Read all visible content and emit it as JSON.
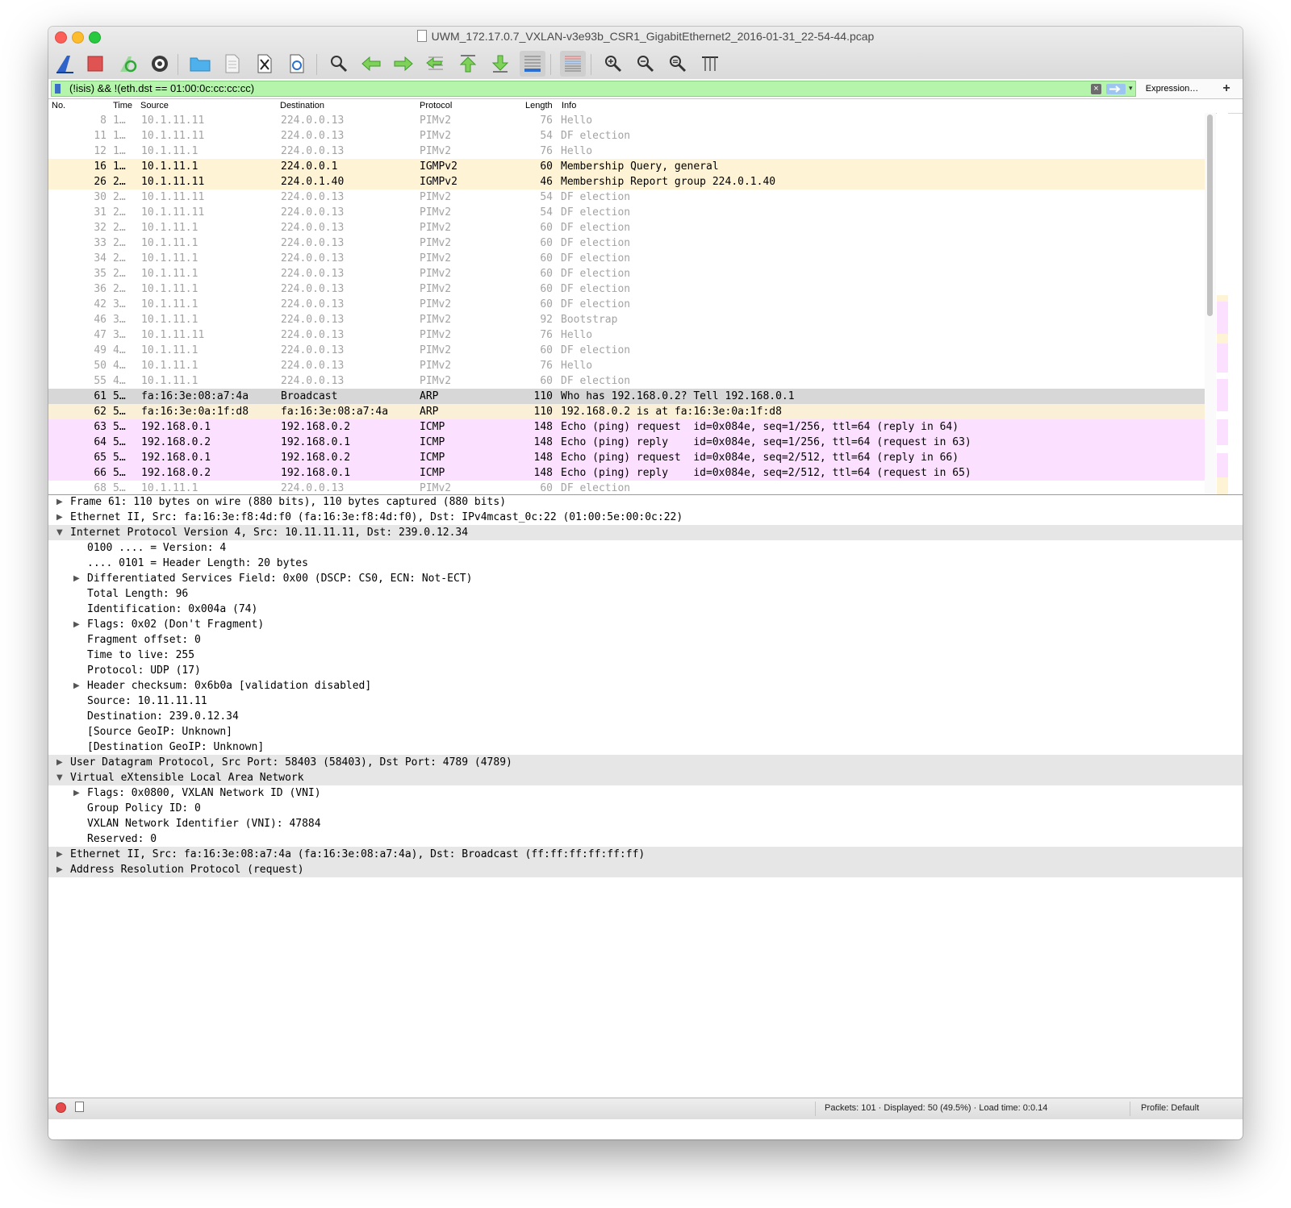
{
  "window": {
    "title": "UWM_172.17.0.7_VXLAN-v3e93b_CSR1_GigabitEthernet2_2016-01-31_22-54-44.pcap"
  },
  "toolbar": {
    "buttons": [
      {
        "name": "start-capture",
        "icon": "shark-fin-icon"
      },
      {
        "name": "stop-capture",
        "icon": "stop-square-icon"
      },
      {
        "name": "restart-capture",
        "icon": "restart-icon"
      },
      {
        "name": "capture-options",
        "icon": "gear-icon"
      },
      {
        "name": "open-file",
        "icon": "folder-icon"
      },
      {
        "name": "save-file",
        "icon": "file-icon"
      },
      {
        "name": "close-file",
        "icon": "close-file-icon"
      },
      {
        "name": "reload-file",
        "icon": "reload-icon"
      },
      {
        "name": "find-packet",
        "icon": "magnifier-icon"
      },
      {
        "name": "go-back",
        "icon": "arrow-left-icon"
      },
      {
        "name": "go-forward",
        "icon": "arrow-right-icon"
      },
      {
        "name": "go-to-packet",
        "icon": "goto-packet-icon"
      },
      {
        "name": "go-first",
        "icon": "arrow-up-icon"
      },
      {
        "name": "go-last",
        "icon": "arrow-down-icon"
      },
      {
        "name": "autoscroll",
        "icon": "autoscroll-icon"
      },
      {
        "name": "colorize",
        "icon": "colorize-icon"
      },
      {
        "name": "zoom-in",
        "icon": "zoom-in-icon"
      },
      {
        "name": "zoom-out",
        "icon": "zoom-out-icon"
      },
      {
        "name": "zoom-normal",
        "icon": "zoom-normal-icon"
      },
      {
        "name": "resize-columns",
        "icon": "resize-columns-icon"
      }
    ]
  },
  "filter": {
    "value": "(!isis) && !(eth.dst == 01:00:0c:cc:cc:cc)",
    "clear_glyph": "×",
    "expression_label": "Expression…",
    "add_label": "+"
  },
  "packet_list": {
    "columns": [
      "No.",
      "Time",
      "Source",
      "Destination",
      "Protocol",
      "Length",
      "Info"
    ],
    "rows": [
      {
        "no": "8",
        "time": "1…",
        "src": "10.1.11.11",
        "dst": "224.0.0.13",
        "proto": "PIMv2",
        "len": "76",
        "info": "Hello",
        "style": "dim"
      },
      {
        "no": "11",
        "time": "1…",
        "src": "10.1.11.11",
        "dst": "224.0.0.13",
        "proto": "PIMv2",
        "len": "54",
        "info": "DF election",
        "style": "dim"
      },
      {
        "no": "12",
        "time": "1…",
        "src": "10.1.11.1",
        "dst": "224.0.0.13",
        "proto": "PIMv2",
        "len": "76",
        "info": "Hello",
        "style": "dim"
      },
      {
        "no": "16",
        "time": "1…",
        "src": "10.1.11.1",
        "dst": "224.0.0.1",
        "proto": "IGMPv2",
        "len": "60",
        "info": "Membership Query, general",
        "style": "igmp"
      },
      {
        "no": "26",
        "time": "2…",
        "src": "10.1.11.11",
        "dst": "224.0.1.40",
        "proto": "IGMPv2",
        "len": "46",
        "info": "Membership Report group 224.0.1.40",
        "style": "igmp"
      },
      {
        "no": "30",
        "time": "2…",
        "src": "10.1.11.11",
        "dst": "224.0.0.13",
        "proto": "PIMv2",
        "len": "54",
        "info": "DF election",
        "style": "dim"
      },
      {
        "no": "31",
        "time": "2…",
        "src": "10.1.11.11",
        "dst": "224.0.0.13",
        "proto": "PIMv2",
        "len": "54",
        "info": "DF election",
        "style": "dim"
      },
      {
        "no": "32",
        "time": "2…",
        "src": "10.1.11.1",
        "dst": "224.0.0.13",
        "proto": "PIMv2",
        "len": "60",
        "info": "DF election",
        "style": "dim"
      },
      {
        "no": "33",
        "time": "2…",
        "src": "10.1.11.1",
        "dst": "224.0.0.13",
        "proto": "PIMv2",
        "len": "60",
        "info": "DF election",
        "style": "dim"
      },
      {
        "no": "34",
        "time": "2…",
        "src": "10.1.11.1",
        "dst": "224.0.0.13",
        "proto": "PIMv2",
        "len": "60",
        "info": "DF election",
        "style": "dim"
      },
      {
        "no": "35",
        "time": "2…",
        "src": "10.1.11.1",
        "dst": "224.0.0.13",
        "proto": "PIMv2",
        "len": "60",
        "info": "DF election",
        "style": "dim"
      },
      {
        "no": "36",
        "time": "2…",
        "src": "10.1.11.1",
        "dst": "224.0.0.13",
        "proto": "PIMv2",
        "len": "60",
        "info": "DF election",
        "style": "dim"
      },
      {
        "no": "42",
        "time": "3…",
        "src": "10.1.11.1",
        "dst": "224.0.0.13",
        "proto": "PIMv2",
        "len": "60",
        "info": "DF election",
        "style": "dim"
      },
      {
        "no": "46",
        "time": "3…",
        "src": "10.1.11.1",
        "dst": "224.0.0.13",
        "proto": "PIMv2",
        "len": "92",
        "info": "Bootstrap",
        "style": "dim"
      },
      {
        "no": "47",
        "time": "3…",
        "src": "10.1.11.11",
        "dst": "224.0.0.13",
        "proto": "PIMv2",
        "len": "76",
        "info": "Hello",
        "style": "dim"
      },
      {
        "no": "49",
        "time": "4…",
        "src": "10.1.11.1",
        "dst": "224.0.0.13",
        "proto": "PIMv2",
        "len": "60",
        "info": "DF election",
        "style": "dim"
      },
      {
        "no": "50",
        "time": "4…",
        "src": "10.1.11.1",
        "dst": "224.0.0.13",
        "proto": "PIMv2",
        "len": "76",
        "info": "Hello",
        "style": "dim"
      },
      {
        "no": "55",
        "time": "4…",
        "src": "10.1.11.1",
        "dst": "224.0.0.13",
        "proto": "PIMv2",
        "len": "60",
        "info": "DF election",
        "style": "dim"
      },
      {
        "no": "61",
        "time": "5…",
        "src": "fa:16:3e:08:a7:4a",
        "dst": "Broadcast",
        "proto": "ARP",
        "len": "110",
        "info": "Who has 192.168.0.2? Tell 192.168.0.1",
        "style": "selected"
      },
      {
        "no": "62",
        "time": "5…",
        "src": "fa:16:3e:0a:1f:d8",
        "dst": "fa:16:3e:08:a7:4a",
        "proto": "ARP",
        "len": "110",
        "info": "192.168.0.2 is at fa:16:3e:0a:1f:d8",
        "style": "arp"
      },
      {
        "no": "63",
        "time": "5…",
        "src": "192.168.0.1",
        "dst": "192.168.0.2",
        "proto": "ICMP",
        "len": "148",
        "info": "Echo (ping) request  id=0x084e, seq=1/256, ttl=64 (reply in 64)",
        "style": "icmp"
      },
      {
        "no": "64",
        "time": "5…",
        "src": "192.168.0.2",
        "dst": "192.168.0.1",
        "proto": "ICMP",
        "len": "148",
        "info": "Echo (ping) reply    id=0x084e, seq=1/256, ttl=64 (request in 63)",
        "style": "icmp"
      },
      {
        "no": "65",
        "time": "5…",
        "src": "192.168.0.1",
        "dst": "192.168.0.2",
        "proto": "ICMP",
        "len": "148",
        "info": "Echo (ping) request  id=0x084e, seq=2/512, ttl=64 (reply in 66)",
        "style": "icmp"
      },
      {
        "no": "66",
        "time": "5…",
        "src": "192.168.0.2",
        "dst": "192.168.0.1",
        "proto": "ICMP",
        "len": "148",
        "info": "Echo (ping) reply    id=0x084e, seq=2/512, ttl=64 (request in 65)",
        "style": "icmp"
      },
      {
        "no": "68",
        "time": "5…",
        "src": "10.1.11.1",
        "dst": "224.0.0.13",
        "proto": "PIMv2",
        "len": "60",
        "info": "DF election",
        "style": "dim"
      }
    ]
  },
  "colors": {
    "dim_text": "#a3a3a3",
    "igmp_bg": "#fff3d6",
    "arp_bg": "#faf0d7",
    "icmp_bg": "#fce0ff",
    "selected_bg": "#d7d7d7",
    "filter_bg": "#b4f5ab"
  },
  "details": {
    "rows": [
      {
        "indent": 0,
        "tri": "right",
        "top": false,
        "text": "Frame 61: 110 bytes on wire (880 bits), 110 bytes captured (880 bits)"
      },
      {
        "indent": 0,
        "tri": "right",
        "top": false,
        "text": "Ethernet II, Src: fa:16:3e:f8:4d:f0 (fa:16:3e:f8:4d:f0), Dst: IPv4mcast_0c:22 (01:00:5e:00:0c:22)"
      },
      {
        "indent": 0,
        "tri": "down",
        "top": true,
        "text": "Internet Protocol Version 4, Src: 10.11.11.11, Dst: 239.0.12.34"
      },
      {
        "indent": 1,
        "tri": "",
        "top": false,
        "text": "0100 .... = Version: 4"
      },
      {
        "indent": 1,
        "tri": "",
        "top": false,
        "text": ".... 0101 = Header Length: 20 bytes"
      },
      {
        "indent": 1,
        "tri": "right",
        "top": false,
        "text": "Differentiated Services Field: 0x00 (DSCP: CS0, ECN: Not-ECT)"
      },
      {
        "indent": 1,
        "tri": "",
        "top": false,
        "text": "Total Length: 96"
      },
      {
        "indent": 1,
        "tri": "",
        "top": false,
        "text": "Identification: 0x004a (74)"
      },
      {
        "indent": 1,
        "tri": "right",
        "top": false,
        "text": "Flags: 0x02 (Don't Fragment)"
      },
      {
        "indent": 1,
        "tri": "",
        "top": false,
        "text": "Fragment offset: 0"
      },
      {
        "indent": 1,
        "tri": "",
        "top": false,
        "text": "Time to live: 255"
      },
      {
        "indent": 1,
        "tri": "",
        "top": false,
        "text": "Protocol: UDP (17)"
      },
      {
        "indent": 1,
        "tri": "right",
        "top": false,
        "text": "Header checksum: 0x6b0a [validation disabled]"
      },
      {
        "indent": 1,
        "tri": "",
        "top": false,
        "text": "Source: 10.11.11.11"
      },
      {
        "indent": 1,
        "tri": "",
        "top": false,
        "text": "Destination: 239.0.12.34"
      },
      {
        "indent": 1,
        "tri": "",
        "top": false,
        "text": "[Source GeoIP: Unknown]"
      },
      {
        "indent": 1,
        "tri": "",
        "top": false,
        "text": "[Destination GeoIP: Unknown]"
      },
      {
        "indent": 0,
        "tri": "right",
        "top": true,
        "text": "User Datagram Protocol, Src Port: 58403 (58403), Dst Port: 4789 (4789)"
      },
      {
        "indent": 0,
        "tri": "down",
        "top": true,
        "text": "Virtual eXtensible Local Area Network"
      },
      {
        "indent": 1,
        "tri": "right",
        "top": false,
        "text": "Flags: 0x0800, VXLAN Network ID (VNI)"
      },
      {
        "indent": 1,
        "tri": "",
        "top": false,
        "text": "Group Policy ID: 0"
      },
      {
        "indent": 1,
        "tri": "",
        "top": false,
        "text": "VXLAN Network Identifier (VNI): 47884"
      },
      {
        "indent": 1,
        "tri": "",
        "top": false,
        "text": "Reserved: 0"
      },
      {
        "indent": 0,
        "tri": "right",
        "top": true,
        "text": "Ethernet II, Src: fa:16:3e:08:a7:4a (fa:16:3e:08:a7:4a), Dst: Broadcast (ff:ff:ff:ff:ff:ff)"
      },
      {
        "indent": 0,
        "tri": "right",
        "top": true,
        "text": "Address Resolution Protocol (request)"
      }
    ]
  },
  "status": {
    "packets": "Packets: 101 · Displayed: 50 (49.5%) · Load time: 0:0.14",
    "profile": "Profile: Default"
  }
}
